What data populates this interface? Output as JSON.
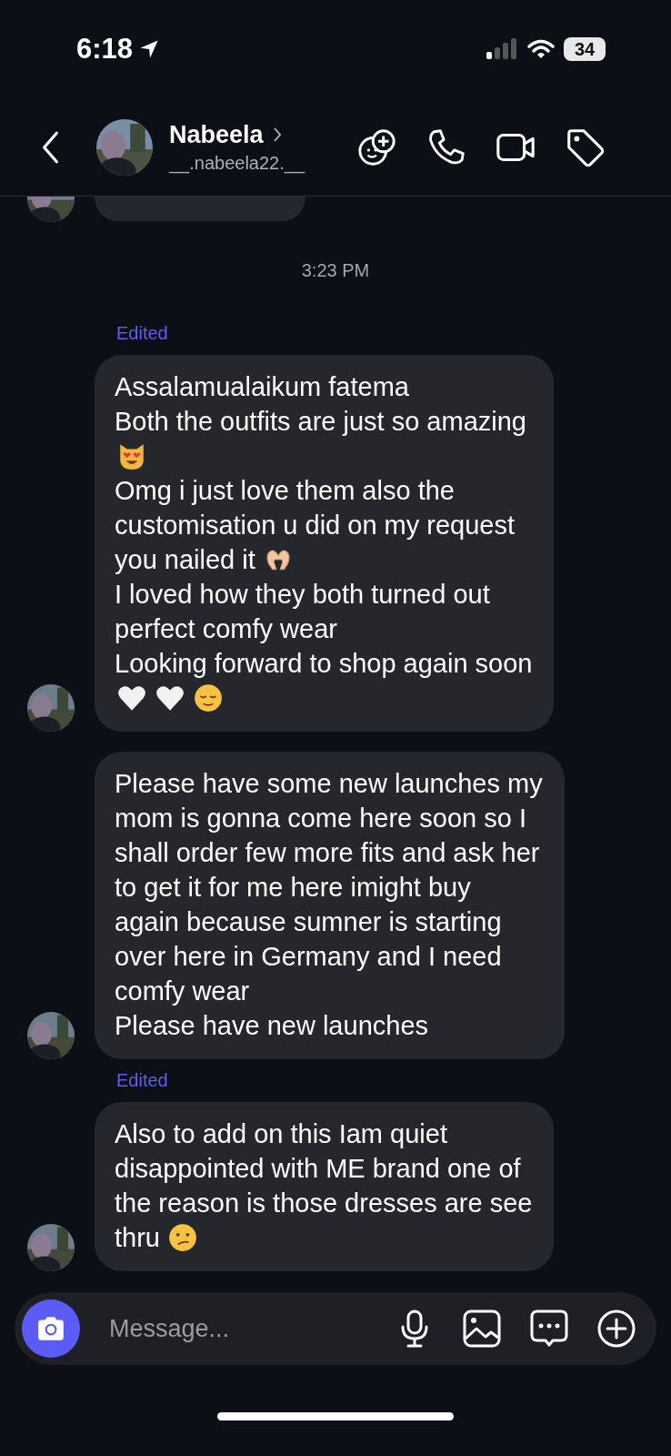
{
  "status_bar": {
    "time": "6:18",
    "battery": "34"
  },
  "header": {
    "name": "Nabeela",
    "username": "__.nabeela22.__"
  },
  "timestamp": "3:23 PM",
  "messages": [
    {
      "edited_label": "Edited",
      "lines": [
        {
          "text": "Assalamualaikum fatema"
        },
        {
          "text": "Both the outfits are just so amazing"
        },
        {
          "emoji": [
            {
              "kind": "heart-eyes-cat"
            }
          ]
        },
        {
          "text": "Omg i just love them also the"
        },
        {
          "text": "customisation u did on my request"
        },
        {
          "text": "you nailed it",
          "emoji": [
            {
              "kind": "heart-hands"
            }
          ]
        },
        {
          "text": "I loved how they both turned out"
        },
        {
          "text": "perfect comfy wear"
        },
        {
          "text": "Looking forward to shop again soon"
        },
        {
          "emoji": [
            {
              "kind": "white-heart"
            },
            {
              "kind": "white-heart"
            },
            {
              "kind": "relieved-face"
            }
          ]
        }
      ]
    },
    {
      "lines": [
        {
          "text": "Please have some new launches my"
        },
        {
          "text": "mom is gonna come here soon so I"
        },
        {
          "text": "shall order few more fits and ask her"
        },
        {
          "text": "to get it for me here imight buy"
        },
        {
          "text": "again because sumner is starting"
        },
        {
          "text": "over here in Germany and I need"
        },
        {
          "text": "comfy wear"
        },
        {
          "text": "Please have new launches"
        }
      ]
    },
    {
      "edited_label": "Edited",
      "lines": [
        {
          "text": "Also to add on this Iam quiet"
        },
        {
          "text": "disappointed with ME brand one of"
        },
        {
          "text": "the reason is those dresses are see"
        },
        {
          "text": "thru",
          "emoji": [
            {
              "kind": "confused-face"
            }
          ]
        }
      ]
    }
  ],
  "composer": {
    "placeholder": "Message..."
  }
}
